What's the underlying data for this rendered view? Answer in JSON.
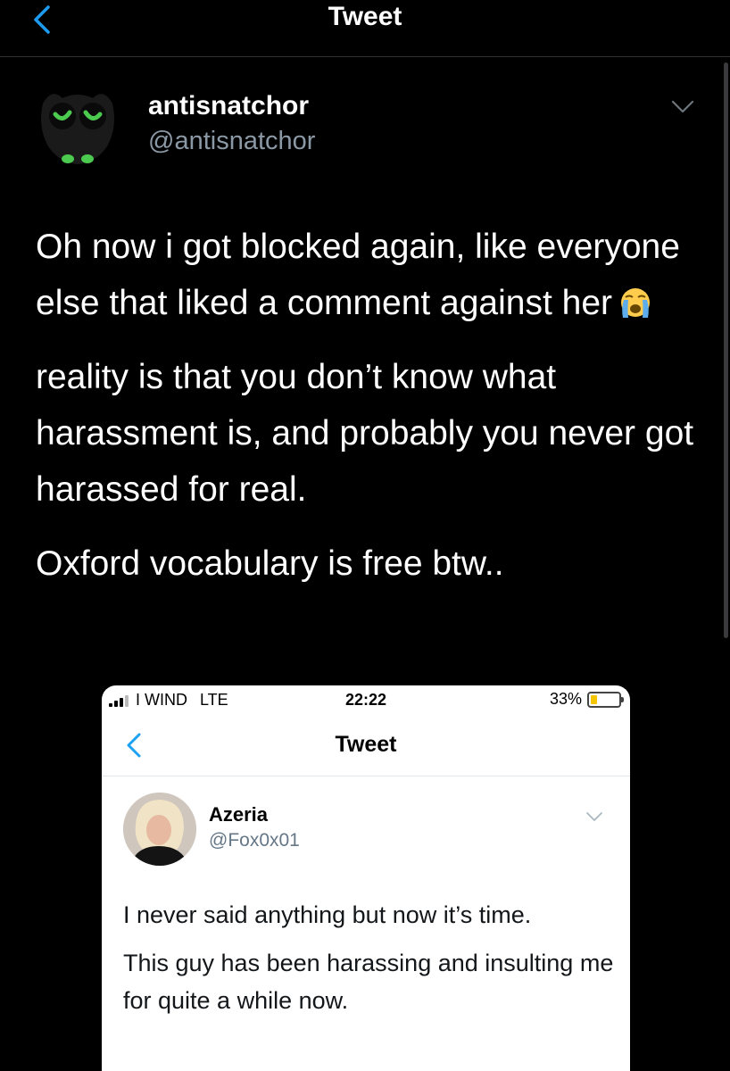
{
  "nav": {
    "title": "Tweet",
    "back_icon": "chevron-left-icon"
  },
  "author": {
    "name": "antisnatchor",
    "handle": "@antisnatchor",
    "menu_icon": "chevron-down-icon"
  },
  "tweet": {
    "paragraphs": [
      "Oh now i got blocked again, like everyone else that liked a comment against her",
      "reality is that you don’t know what harassment is, and probably you never got harassed for real.",
      "Oxford vocabulary is free btw.."
    ],
    "emoji": "loudly-crying-face-icon"
  },
  "embedded_screenshot": {
    "status_bar": {
      "carrier": "I WIND",
      "network": "LTE",
      "time": "22:22",
      "battery": "33%",
      "battery_level": 0.33
    },
    "nav": {
      "title": "Tweet"
    },
    "author": {
      "name": "Azeria",
      "handle": "@Fox0x01"
    },
    "paragraphs": [
      "I never said anything but now it’s time.",
      "This guy has been harassing and insulting me for quite a while now."
    ]
  },
  "colors": {
    "background": "#000000",
    "accent": "#1d9bf0",
    "secondary_text": "#8b98a5",
    "owl_eyes": "#4cc94f"
  }
}
